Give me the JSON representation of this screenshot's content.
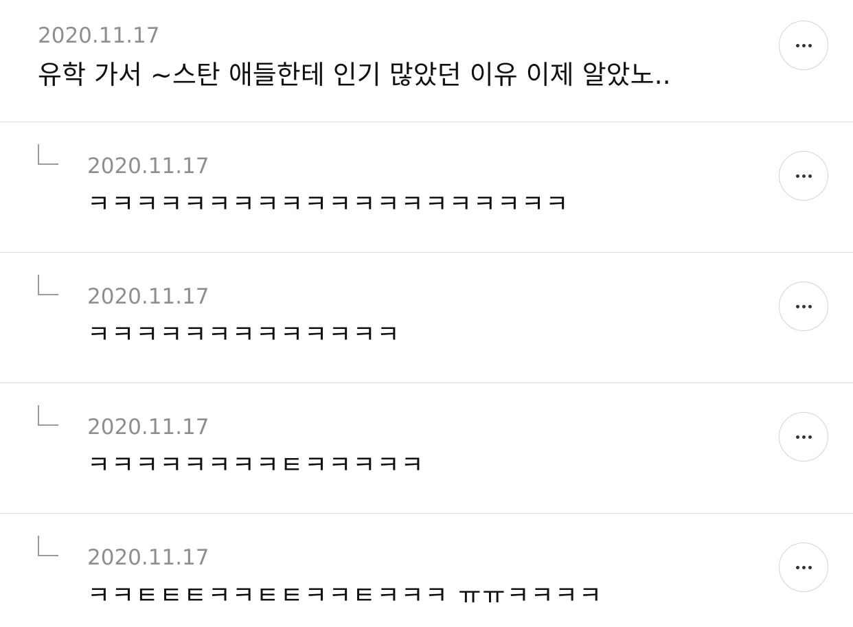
{
  "comments": [
    {
      "date": "2020.11.17",
      "text": "유학 가서 ~스탄 애들한테 인기 많았던 이유 이제 알았노..",
      "is_reply": false,
      "more_icon": "more-horizontal-icon"
    },
    {
      "date": "2020.11.17",
      "text": "ㅋㅋㅋㅋㅋㅋㅋㅋㅋㅋㅋㅋㅋㅋㅋㅋㅋㅋㅋㅋ",
      "is_reply": true,
      "more_icon": "more-horizontal-icon"
    },
    {
      "date": "2020.11.17",
      "text": "ㅋㅋㅋㅋㅋㅋㅋㅋㅋㅋㅋㅋㅋ",
      "is_reply": true,
      "more_icon": "more-horizontal-icon"
    },
    {
      "date": "2020.11.17",
      "text": "ㅋㅋㅋㅋㅋㅋㅋㅋㅌㅋㅋㅋㅋㅋ",
      "is_reply": true,
      "more_icon": "more-horizontal-icon"
    },
    {
      "date": "2020.11.17",
      "text": "ㅋㅋㅌㅌㅌㅋㅋㅌㅌㅋㅋㅌㅋㅋㅋ ㅠㅠㅋㅋㅋㅋ",
      "is_reply": true,
      "more_icon": "more-horizontal-icon"
    }
  ]
}
